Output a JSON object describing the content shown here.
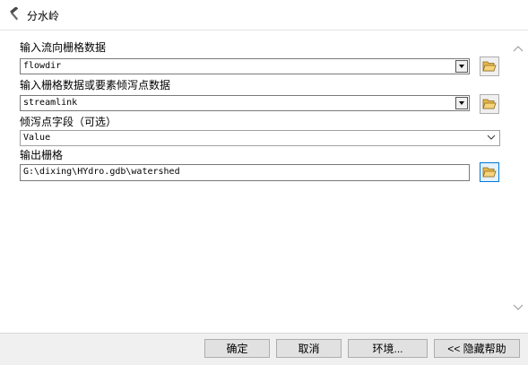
{
  "window": {
    "title": "分水岭",
    "icon": "hammer-icon"
  },
  "fields": {
    "flow_direction": {
      "label": "输入流向栅格数据",
      "value": "flowdir"
    },
    "pour_point": {
      "label": "输入栅格数据或要素倾泻点数据",
      "value": "streamlink"
    },
    "pour_point_field": {
      "label": "倾泻点字段（可选）",
      "value": "Value"
    },
    "output": {
      "label": "输出栅格",
      "value": "G:\\dixing\\HYdro.gdb\\watershed"
    }
  },
  "buttons": {
    "ok": "确定",
    "cancel": "取消",
    "environments": "环境...",
    "hide_help": "<< 隐藏帮助"
  },
  "colors": {
    "active_border": "#0078d7",
    "folder_yellow": "#e8b84a"
  }
}
